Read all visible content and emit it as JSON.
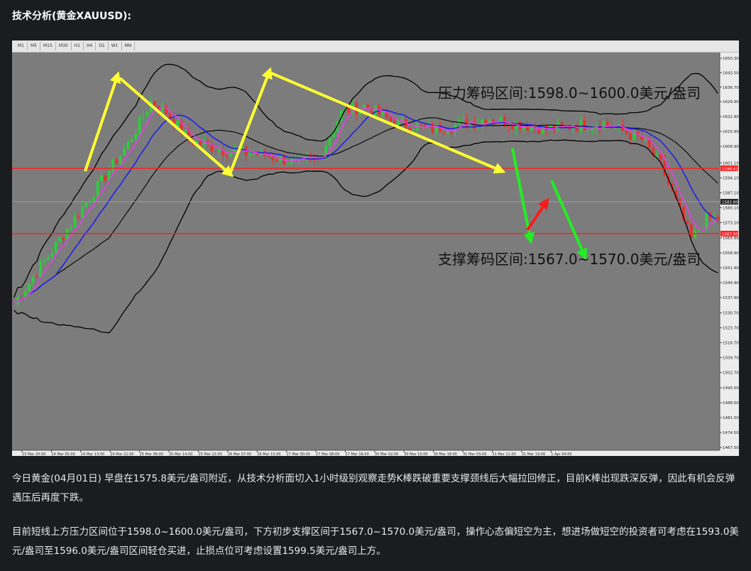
{
  "page": {
    "title": "技术分析(黄金XAUUSD):",
    "paragraph1": "今日黄金(04月01日) 早盘在1575.8美元/盎司附近，从技术分析面切入1小时级别观察走势K棒跌破重要支撑颈线后大幅拉回修正，目前K棒出现跌深反弹，因此有机会反弹遇压后再度下跌。",
    "paragraph2": "目前短线上方压力区间位于1598.0~1600.0美元/盎司，下方初步支撑区间于1567.0~1570.0美元/盎司，操作心态偏短空为主，想进场做短空的投资者可考虑在1593.0美元/盎司至1596.0美元/盎司区间轻仓买进，止损点位可考虑设置1599.5美元/盎司上方。"
  },
  "toolbar": {
    "timeframes": [
      "M1",
      "M5",
      "M15",
      "M30",
      "H1",
      "H4",
      "D1",
      "W1",
      "MN"
    ]
  },
  "chart_data": {
    "type": "candlestick",
    "symbol": "XAUUSD",
    "timeframe": "H1",
    "annotations": {
      "resistance": "压力筹码区间:1598.0~1600.0美元/盎司",
      "support": "支撑筹码区间:1567.0~1570.0美元/盎司"
    },
    "y_ticks": [
      "1650.30",
      "1643.50",
      "1636.70",
      "1629.90",
      "1622.90",
      "1615.90",
      "1608.90",
      "1601.10",
      "1594.10",
      "1587.10",
      "1580.10",
      "1573.10",
      "1565.90",
      "1558.90",
      "1551.90",
      "1544.90",
      "1537.90",
      "1530.70",
      "1523.70",
      "1516.70",
      "1509.70",
      "1502.70",
      "1495.50",
      "1488.50",
      "1481.50",
      "1474.50",
      "1467.50"
    ],
    "ylim": [
      1467.5,
      1650.3
    ],
    "x_ticks": [
      "23 Mar 20:00",
      "24 Mar 05:00",
      "24 Mar 13:00",
      "24 Mar 21:00",
      "25 Mar 06:00",
      "25 Mar 14:00",
      "25 Mar 22:00",
      "26 Mar 07:00",
      "26 Mar 15:00",
      "27 Mar 00:00",
      "27 Mar 08:00",
      "27 Mar 16:00",
      "30 Mar 02:00",
      "30 Mar 10:00",
      "30 Mar 18:00",
      "31 Mar 03:00",
      "31 Mar 11:00",
      "31 Mar 19:00",
      "1 Apr 04:00"
    ],
    "price_labels": {
      "resistance_line": "1598.61",
      "current": "1582.89",
      "support_line": "1567.93"
    },
    "horizontal_lines": [
      {
        "name": "resistance-line",
        "value": 1598.61,
        "color": "#ff2020"
      },
      {
        "name": "support-line",
        "value": 1567.93,
        "color": "#ff2020"
      }
    ],
    "current_price": 1582.89,
    "key_points": [
      {
        "x": 0,
        "close": 1535
      },
      {
        "x": 10,
        "close": 1560
      },
      {
        "x": 20,
        "close": 1585
      },
      {
        "x": 30,
        "close": 1610
      },
      {
        "x": 36,
        "close": 1630
      },
      {
        "x": 40,
        "close": 1625
      },
      {
        "x": 46,
        "close": 1612
      },
      {
        "x": 55,
        "close": 1607
      },
      {
        "x": 65,
        "close": 1605
      },
      {
        "x": 75,
        "close": 1601
      },
      {
        "x": 80,
        "close": 1603
      },
      {
        "x": 86,
        "close": 1625
      },
      {
        "x": 92,
        "close": 1628
      },
      {
        "x": 100,
        "close": 1620
      },
      {
        "x": 110,
        "close": 1617
      },
      {
        "x": 125,
        "close": 1622
      },
      {
        "x": 140,
        "close": 1617
      },
      {
        "x": 155,
        "close": 1620
      },
      {
        "x": 165,
        "close": 1612
      },
      {
        "x": 170,
        "close": 1600
      },
      {
        "x": 178,
        "close": 1565
      },
      {
        "x": 182,
        "close": 1575
      }
    ],
    "colors": {
      "background": "#7c7c7c",
      "bull": "#2ecc40",
      "bear": "#e8322a",
      "ma_fast": "#e83de8",
      "ma_slow": "#2020e8",
      "bollinger": "#000000",
      "arrow_yellow": "#ffff33",
      "arrow_green": "#22ee22",
      "arrow_red": "#ff1a1a"
    }
  }
}
